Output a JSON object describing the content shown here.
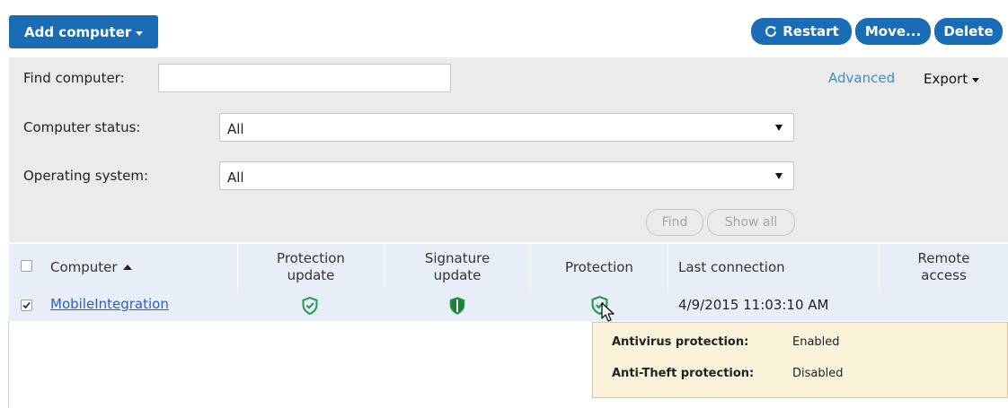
{
  "toolbar": {
    "add_computer_label": "Add computer",
    "restart_label": "Restart",
    "move_label": "Move...",
    "delete_label": "Delete"
  },
  "filters": {
    "find_label": "Find computer:",
    "find_value": "",
    "status_label": "Computer status:",
    "status_value": "All",
    "os_label": "Operating system:",
    "os_value": "All",
    "advanced_label": "Advanced",
    "export_label": "Export",
    "find_button": "Find",
    "show_all_button": "Show all"
  },
  "table": {
    "columns": {
      "computer": "Computer",
      "protection_update": "Protection update",
      "signature_update": "Signature update",
      "protection": "Protection",
      "last_connection": "Last connection",
      "remote_access": "Remote access"
    },
    "rows": [
      {
        "checked": true,
        "computer": "MobileIntegration",
        "protection_update_icon": "shield-check-icon",
        "signature_update_icon": "shield-half-icon",
        "protection_icon": "shield-check-icon",
        "last_connection": "4/9/2015 11:03:10 AM",
        "remote_access": ""
      }
    ]
  },
  "tooltip": {
    "antivirus_label": "Antivirus protection:",
    "antivirus_value": "Enabled",
    "antitheft_label": "Anti-Theft protection:",
    "antitheft_value": "Disabled"
  },
  "colors": {
    "primary": "#1a6db4",
    "status_green": "#1f9a46",
    "link": "#2a5fc2",
    "tooltip_bg": "#fbf3d9"
  }
}
